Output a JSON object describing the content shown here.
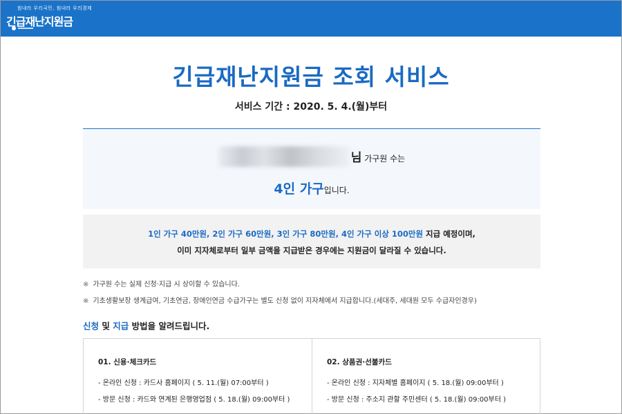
{
  "header": {
    "slogan": "힘내라 우리국민, 힘내라 우리경제",
    "title": "긴급재난지원금",
    "emblem_label": "대한민국정부",
    "color": "#1a73c8"
  },
  "page": {
    "title": "긴급재난지원금 조회 서비스",
    "service_period": "서비스 기간 : 2020. 5. 4.(월)부터"
  },
  "household": {
    "name_suffix": "님",
    "line1_text": " 가구원 수는",
    "count": "4인 가구",
    "line2_suffix": "입니다."
  },
  "info": {
    "amounts": "1인 가구 40만원, 2인 가구 60만원, 3인 가구 80만원, 4인 가구 이상 100만원",
    "amounts_suffix": " 지급 예정이며,",
    "line2": "이미 지자체로부터 일부 금액을 지급받은 경우에는 지원금이 달라질 수 있습니다."
  },
  "notes": {
    "mark": "※",
    "note1": "가구원 수는 실제 신청·지급 시 상이할 수 있습니다.",
    "note2": "기초생활보장 생계급여, 기초연금, 장애인연금 수급가구는 별도 신청 없이 지자체에서 지급합니다.(세대주, 세대원 모두 수급자인경우)"
  },
  "method_heading": {
    "apply": "신청",
    "and": " 및 ",
    "pay": "지급",
    "rest": " 방법을 알려드립니다."
  },
  "methods": [
    {
      "title": "01. 신용·체크카드",
      "items": [
        "- 온라인 신청 : 카드사 홈페이지 ( 5. 11.(월) 07:00부터 )",
        "- 방문 신청 : 카드와 연계된 은행영업점 ( 5. 18.(월) 09:00부터 )"
      ]
    },
    {
      "title": "02. 상품권·선불카드",
      "items": [
        "- 온라인 신청 : 지자체별 홈페이지 ( 5. 18.(월) 09:00부터 )",
        "- 방문 신청 : 주소지 관할 주민센터 ( 5. 18.(월) 09:00부터 )"
      ]
    }
  ]
}
